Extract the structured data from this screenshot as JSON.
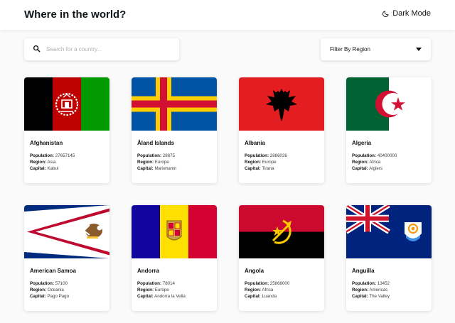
{
  "header": {
    "title": "Where in the world?",
    "dark_mode_label": "Dark Mode",
    "icon": "moon-icon"
  },
  "search": {
    "placeholder": "Search for a country...",
    "icon": "search-icon"
  },
  "filter": {
    "label": "Filter By Region",
    "icon": "caret-down-icon"
  },
  "labels": {
    "population": "Population:",
    "region": "Region:",
    "capital": "Capital:"
  },
  "countries": [
    {
      "name": "Afghanistan",
      "population": "27657145",
      "region": "Asia",
      "capital": "Kabul",
      "flag": "afghanistan-flag"
    },
    {
      "name": "Åland Islands",
      "population": "28875",
      "region": "Europe",
      "capital": "Mariehamn",
      "flag": "aland-islands-flag"
    },
    {
      "name": "Albania",
      "population": "2886026",
      "region": "Europe",
      "capital": "Tirana",
      "flag": "albania-flag"
    },
    {
      "name": "Algeria",
      "population": "40400000",
      "region": "Africa",
      "capital": "Algiers",
      "flag": "algeria-flag"
    },
    {
      "name": "American Samoa",
      "population": "57100",
      "region": "Oceania",
      "capital": "Pago Pago",
      "flag": "american-samoa-flag"
    },
    {
      "name": "Andorra",
      "population": "78014",
      "region": "Europe",
      "capital": "Andorra la Vella",
      "flag": "andorra-flag"
    },
    {
      "name": "Angola",
      "population": "25868000",
      "region": "Africa",
      "capital": "Luanda",
      "flag": "angola-flag"
    },
    {
      "name": "Anguilla",
      "population": "13452",
      "region": "Americas",
      "capital": "The Valley",
      "flag": "anguilla-flag"
    }
  ],
  "colors": {
    "background": "#fafafa",
    "card": "#ffffff",
    "text": "#111517",
    "placeholder": "#b2b2b2"
  }
}
